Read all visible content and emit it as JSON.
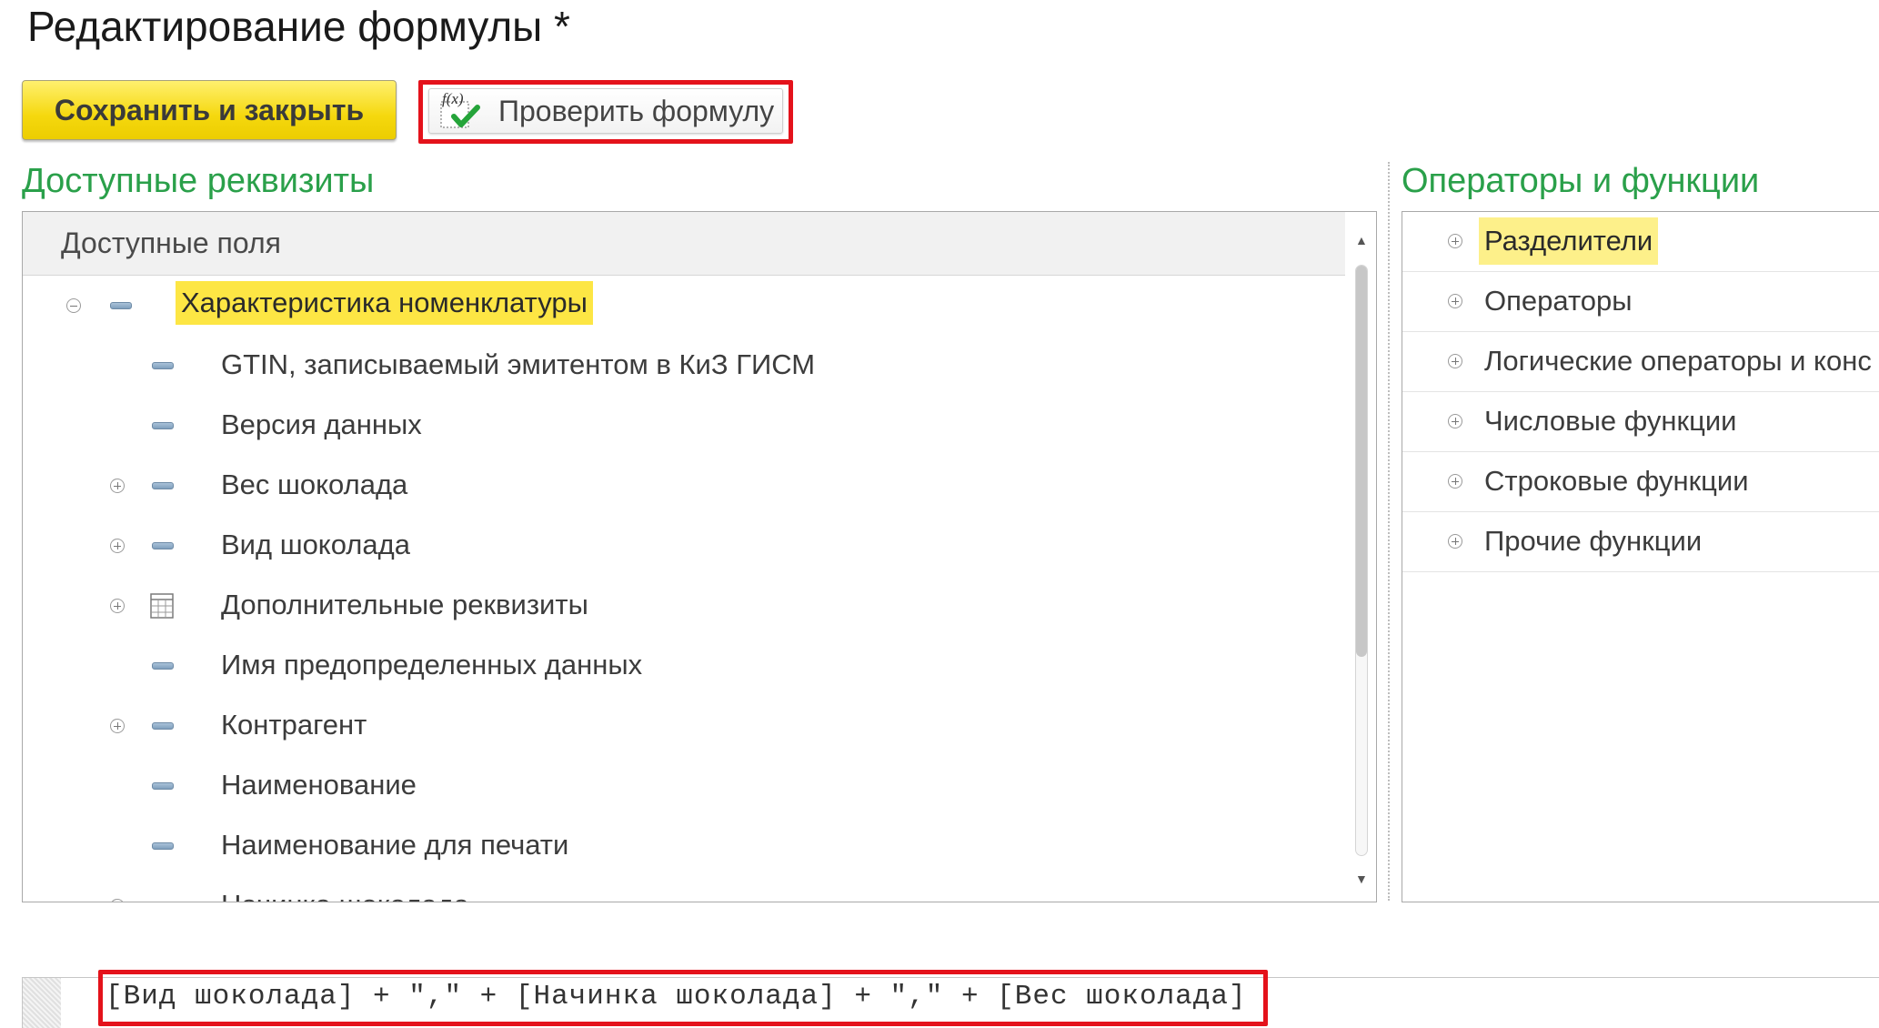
{
  "window": {
    "title": "Редактирование формулы *"
  },
  "toolbar": {
    "save_close_label": "Сохранить и закрыть",
    "check_formula_label": "Проверить формулу",
    "check_formula_icon": "function-check-icon"
  },
  "left_section": {
    "heading": "Доступные реквизиты",
    "column_header": "Доступные поля",
    "rows": [
      {
        "label": "Характеристика номенклатуры",
        "level": 0,
        "expander": "minus",
        "icon": "attribute-icon",
        "highlighted": true
      },
      {
        "label": "GTIN, записываемый эмитентом в КиЗ ГИСМ",
        "level": 1,
        "expander": "none",
        "icon": "attribute-icon"
      },
      {
        "label": "Версия данных",
        "level": 1,
        "expander": "none",
        "icon": "attribute-icon"
      },
      {
        "label": "Вес шоколада",
        "level": 1,
        "expander": "plus",
        "icon": "attribute-icon"
      },
      {
        "label": "Вид шоколада",
        "level": 1,
        "expander": "plus",
        "icon": "attribute-icon"
      },
      {
        "label": "Дополнительные реквизиты",
        "level": 1,
        "expander": "plus",
        "icon": "table-icon"
      },
      {
        "label": "Имя предопределенных данных",
        "level": 1,
        "expander": "none",
        "icon": "attribute-icon"
      },
      {
        "label": "Контрагент",
        "level": 1,
        "expander": "plus",
        "icon": "attribute-icon"
      },
      {
        "label": "Наименование",
        "level": 1,
        "expander": "none",
        "icon": "attribute-icon"
      },
      {
        "label": "Наименование для печати",
        "level": 1,
        "expander": "none",
        "icon": "attribute-icon"
      },
      {
        "label": "Начинка шоколада",
        "level": 1,
        "expander": "plus",
        "icon": "attribute-icon"
      }
    ]
  },
  "right_section": {
    "heading": "Операторы и функции",
    "rows": [
      {
        "label": "Разделители",
        "highlighted": true
      },
      {
        "label": "Операторы"
      },
      {
        "label": "Логические операторы и конс"
      },
      {
        "label": "Числовые функции"
      },
      {
        "label": "Строковые функции"
      },
      {
        "label": "Прочие функции"
      }
    ]
  },
  "formula": {
    "text": "[Вид шоколада] + \",\" + [Начинка шоколада] + \",\" + [Вес шоколада]"
  },
  "colors": {
    "heading_green": "#2aa04a",
    "primary_button_yellow": "#f5d80e",
    "highlight_yellow": "#fde644",
    "annotation_red": "#e4121b"
  }
}
